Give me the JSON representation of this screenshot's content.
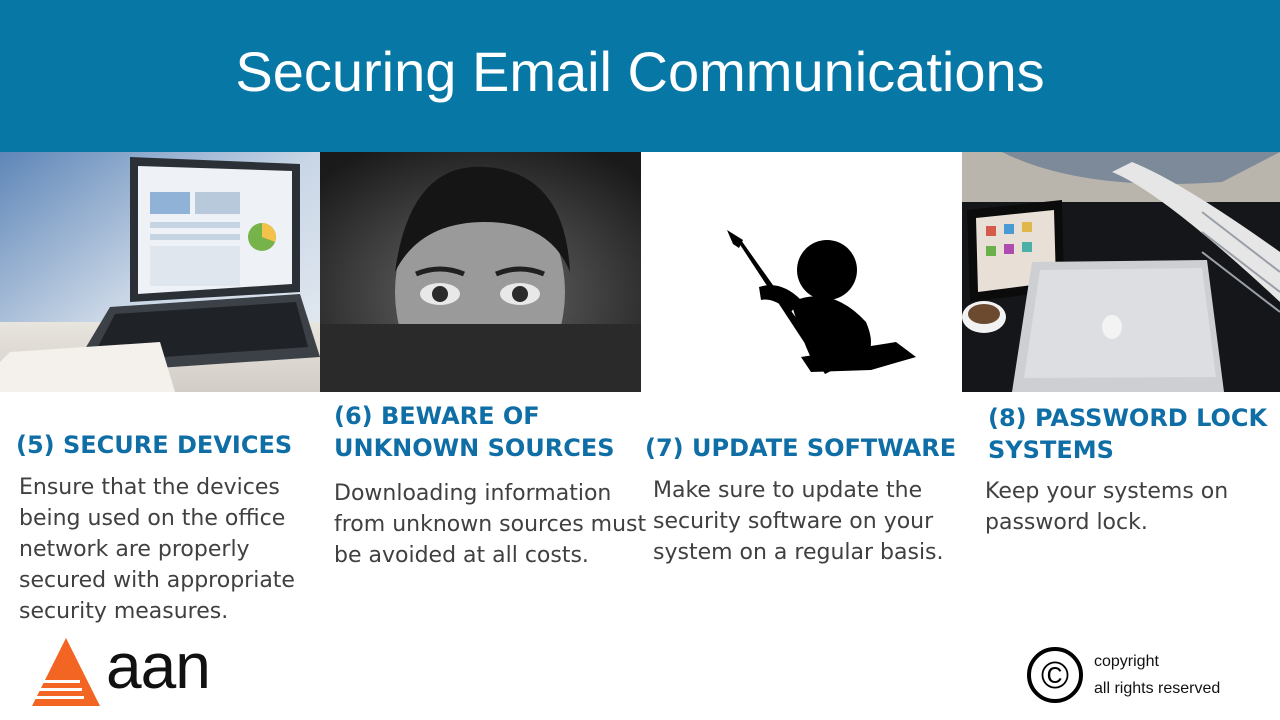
{
  "slide": {
    "title": "Securing Email Communications",
    "colors": {
      "header": "#0778a6",
      "heading": "#0f6ea5",
      "body": "#404040",
      "logo_orange": "#f26522"
    }
  },
  "cards": [
    {
      "heading": "(5) SECURE  DEVICES",
      "body": [
        "Ensure that the devices",
        "being used on the office",
        "network are properly",
        "secured with appropriate",
        "security measures."
      ],
      "image": "laptop-photo"
    },
    {
      "heading_lines": [
        "(6) BEWARE OF",
        "UNKNOWN SOURCES"
      ],
      "body": [
        "Downloading information",
        "from unknown sources must",
        "be avoided at all costs."
      ],
      "image": "peeking-man-photo"
    },
    {
      "heading": "(7) UPDATE SOFTWARE",
      "body": [
        "Make sure to update the",
        "security software on your",
        "system on a regular basis."
      ],
      "image": "figure-with-pen-silhouette"
    },
    {
      "heading_lines": [
        "(8) PASSWORD LOCK",
        "SYSTEMS"
      ],
      "body": [
        "Keep your systems on",
        "password lock."
      ],
      "image": "desk-devices-photo"
    }
  ],
  "logo": {
    "text": "aan"
  },
  "copyright": {
    "symbol": "©",
    "line1": "copyright",
    "line2": "all rights reserved"
  }
}
